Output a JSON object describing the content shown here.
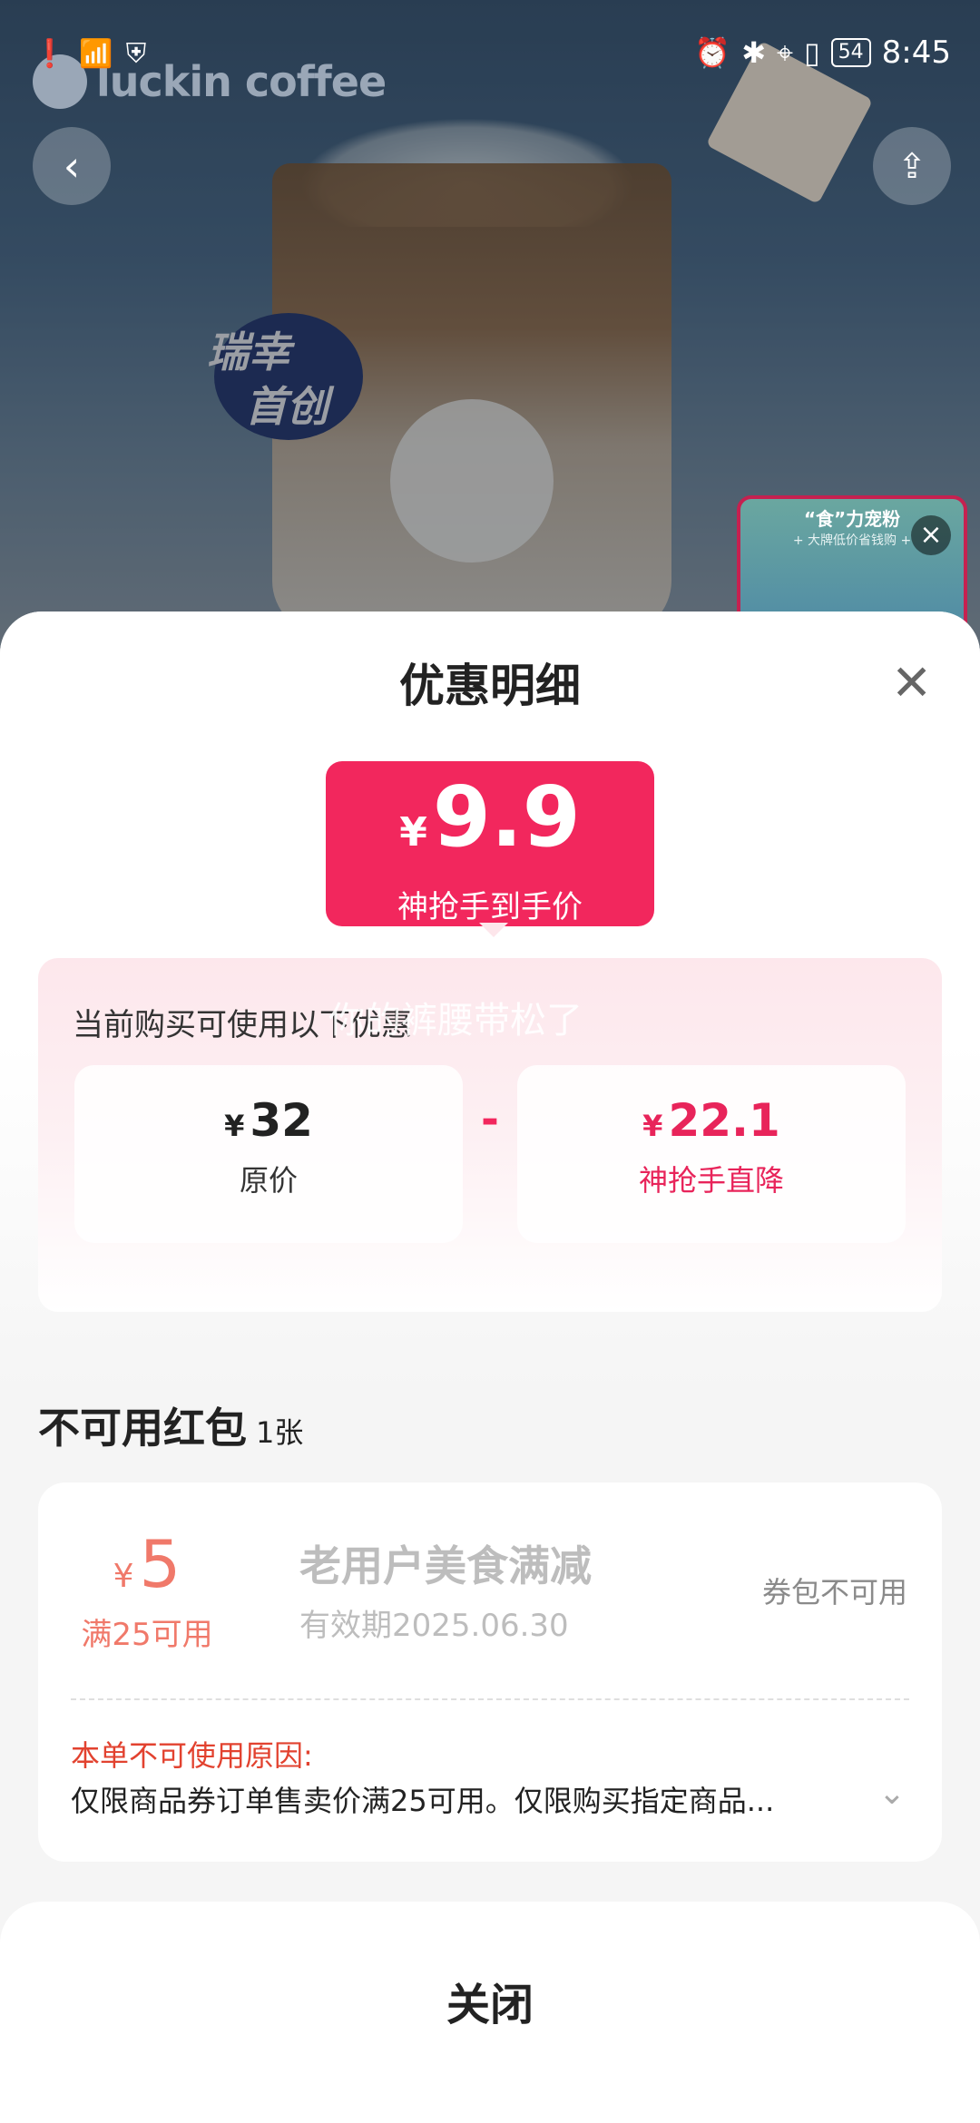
{
  "status_bar": {
    "battery": "54",
    "time": "8:45"
  },
  "header": {
    "brand": "luckin coffee",
    "badge_line1": "瑞幸",
    "badge_line2": "首创"
  },
  "promo": {
    "title": "“食”力宠粉",
    "subtitle": "+ 大牌低价省钱购 +"
  },
  "sheet": {
    "title": "优惠明细",
    "final_price": {
      "currency": "¥",
      "value": "9.9",
      "label": "神抢手到手价"
    },
    "hint": "当前购买可使用以下优惠",
    "watermark": "你的裤腰带松了",
    "original": {
      "currency": "¥",
      "value": "32",
      "label": "原价"
    },
    "minus": "-",
    "discount": {
      "currency": "¥",
      "value": "22.1",
      "label": "神抢手直降"
    }
  },
  "unusable": {
    "title": "不可用红包",
    "count": "1张",
    "coupon": {
      "currency": "¥",
      "amount": "5",
      "condition": "满25可用",
      "name": "老用户美食满减",
      "validity": "有效期2025.06.30",
      "state": "券包不可用",
      "reason_title": "本单不可使用原因:",
      "reason": "仅限商品券订单售卖价满25可用。仅限购买指定商品..."
    }
  },
  "footer": {
    "close_label": "关闭"
  },
  "colors": {
    "accent": "#f2275d",
    "coupon": "#f0796a",
    "reason": "#e2422f"
  }
}
